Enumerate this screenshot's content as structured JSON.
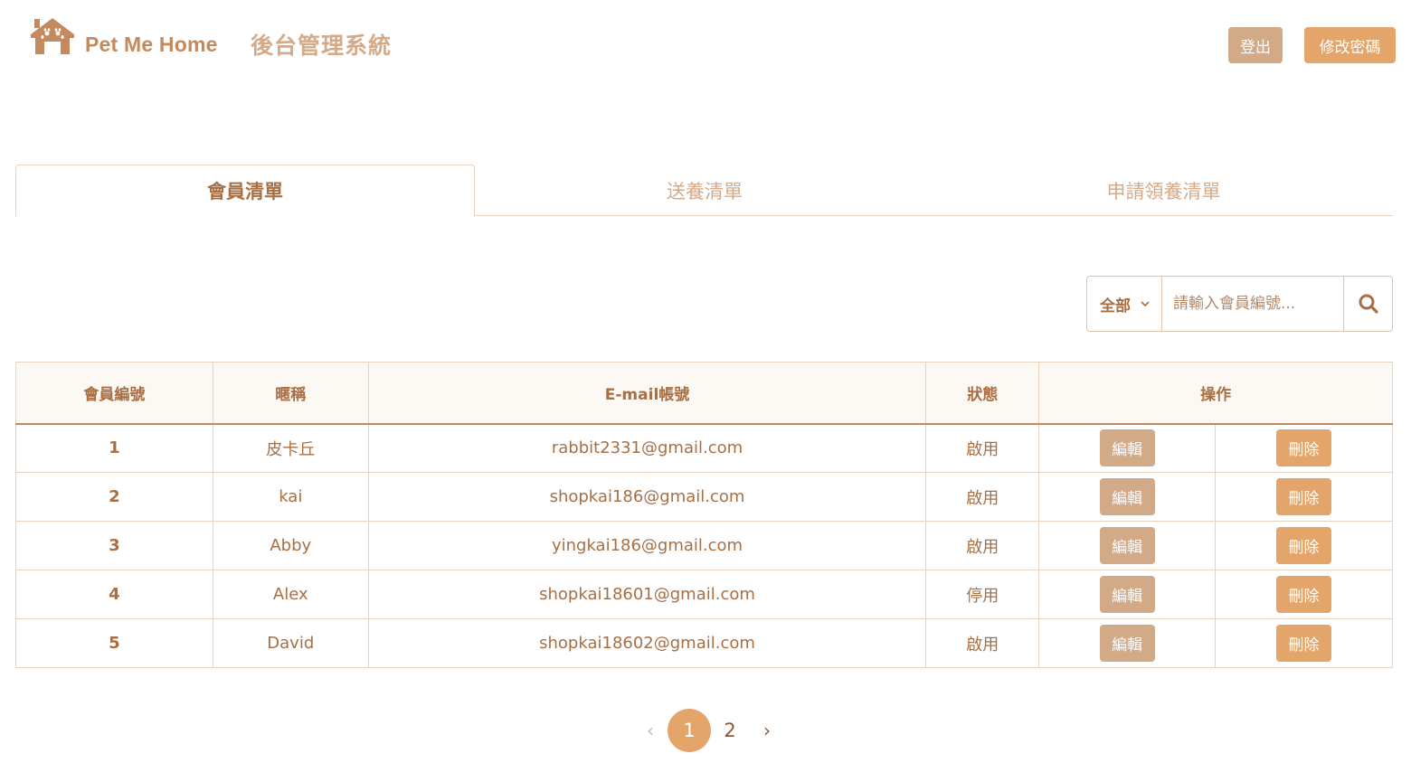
{
  "header": {
    "brand": "Pet Me Home",
    "system_title": "後台管理系統",
    "logout_label": "登出",
    "change_password_label": "修改密碼"
  },
  "tabs": [
    {
      "label": "會員清單",
      "active": true
    },
    {
      "label": "送養清單",
      "active": false
    },
    {
      "label": "申請領養清單",
      "active": false
    }
  ],
  "search": {
    "filter_value": "全部",
    "placeholder": "請輸入會員編號...",
    "icon": "search-icon"
  },
  "table": {
    "columns": [
      "會員編號",
      "暱稱",
      "E-mail帳號",
      "狀態",
      "操作"
    ],
    "edit_label": "編輯",
    "delete_label": "刪除",
    "rows": [
      {
        "id": "1",
        "nickname": "皮卡丘",
        "email": "rabbit2331@gmail.com",
        "status": "啟用"
      },
      {
        "id": "2",
        "nickname": "kai",
        "email": "shopkai186@gmail.com",
        "status": "啟用"
      },
      {
        "id": "3",
        "nickname": "Abby",
        "email": "yingkai186@gmail.com",
        "status": "啟用"
      },
      {
        "id": "4",
        "nickname": "Alex",
        "email": "shopkai18601@gmail.com",
        "status": "停用"
      },
      {
        "id": "5",
        "nickname": "David",
        "email": "shopkai18602@gmail.com",
        "status": "啟用"
      }
    ]
  },
  "pagination": {
    "prev": "‹",
    "pages": [
      "1",
      "2"
    ],
    "current": "1",
    "next": "›"
  },
  "colors": {
    "primary": "#e4a56a",
    "secondary": "#d3aa87",
    "text": "#a86f44",
    "border": "#e7d3c2"
  }
}
